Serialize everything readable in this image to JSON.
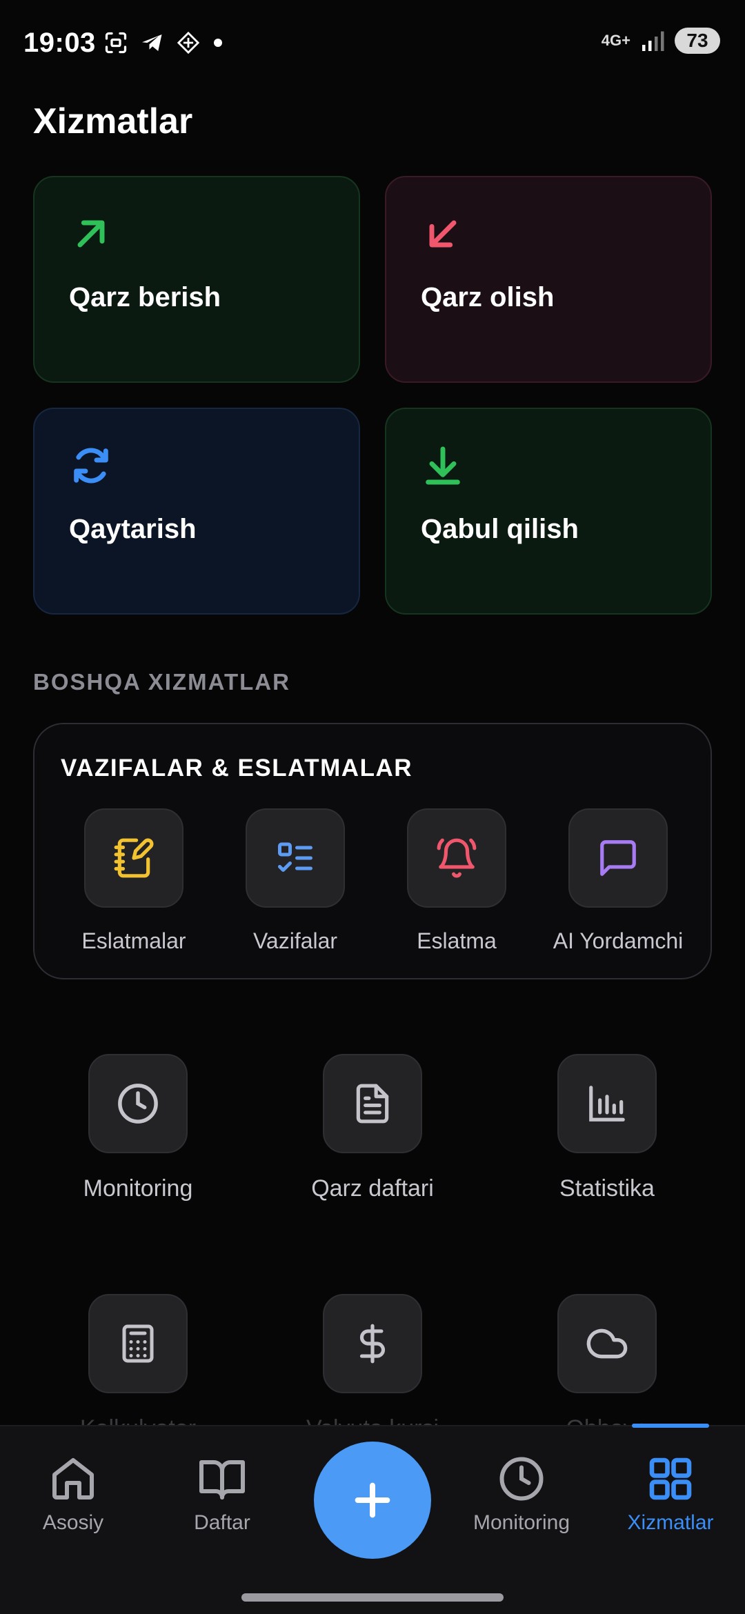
{
  "status_bar": {
    "time": "19:03",
    "network": "4G+",
    "battery": "73"
  },
  "page_title": "Xizmatlar",
  "actions": [
    {
      "label": "Qarz berish",
      "icon": "arrow-up-right-icon",
      "color": "#2fc05a"
    },
    {
      "label": "Qarz olish",
      "icon": "arrow-down-left-icon",
      "color": "#f0576c"
    },
    {
      "label": "Qaytarish",
      "icon": "refresh-icon",
      "color": "#3b8ef5"
    },
    {
      "label": "Qabul qilish",
      "icon": "download-icon",
      "color": "#2fc05a"
    }
  ],
  "section_title": "BOSHQA XIZMATLAR",
  "tasks_panel": {
    "title": "VAZIFALAR & ESLATMALAR",
    "items": [
      {
        "label": "Eslatmalar",
        "icon": "notebook-pen-icon",
        "color": "#f2c230"
      },
      {
        "label": "Vazifalar",
        "icon": "list-checks-icon",
        "color": "#5e9cf4"
      },
      {
        "label": "Eslatma",
        "icon": "bell-icon",
        "color": "#f0576c"
      },
      {
        "label": "AI Yordamchi",
        "icon": "message-square-icon",
        "color": "#a77cf2"
      }
    ]
  },
  "services": [
    {
      "label": "Monitoring",
      "icon": "clock-icon"
    },
    {
      "label": "Qarz daftari",
      "icon": "file-text-icon"
    },
    {
      "label": "Statistika",
      "icon": "bar-chart-icon"
    },
    {
      "label": "Kalkulyator",
      "icon": "calculator-icon"
    },
    {
      "label": "Valyuta kursi",
      "icon": "dollar-icon"
    },
    {
      "label": "Obhavo",
      "icon": "cloud-icon"
    }
  ],
  "bottom_nav": {
    "items": [
      {
        "label": "Asosiy",
        "icon": "home-icon"
      },
      {
        "label": "Daftar",
        "icon": "book-open-icon"
      },
      {
        "label": "Monitoring",
        "icon": "clock-icon"
      },
      {
        "label": "Xizmatlar",
        "icon": "grid-icon"
      }
    ],
    "fab_icon": "plus-icon",
    "active_color": "#3b8ef5"
  }
}
